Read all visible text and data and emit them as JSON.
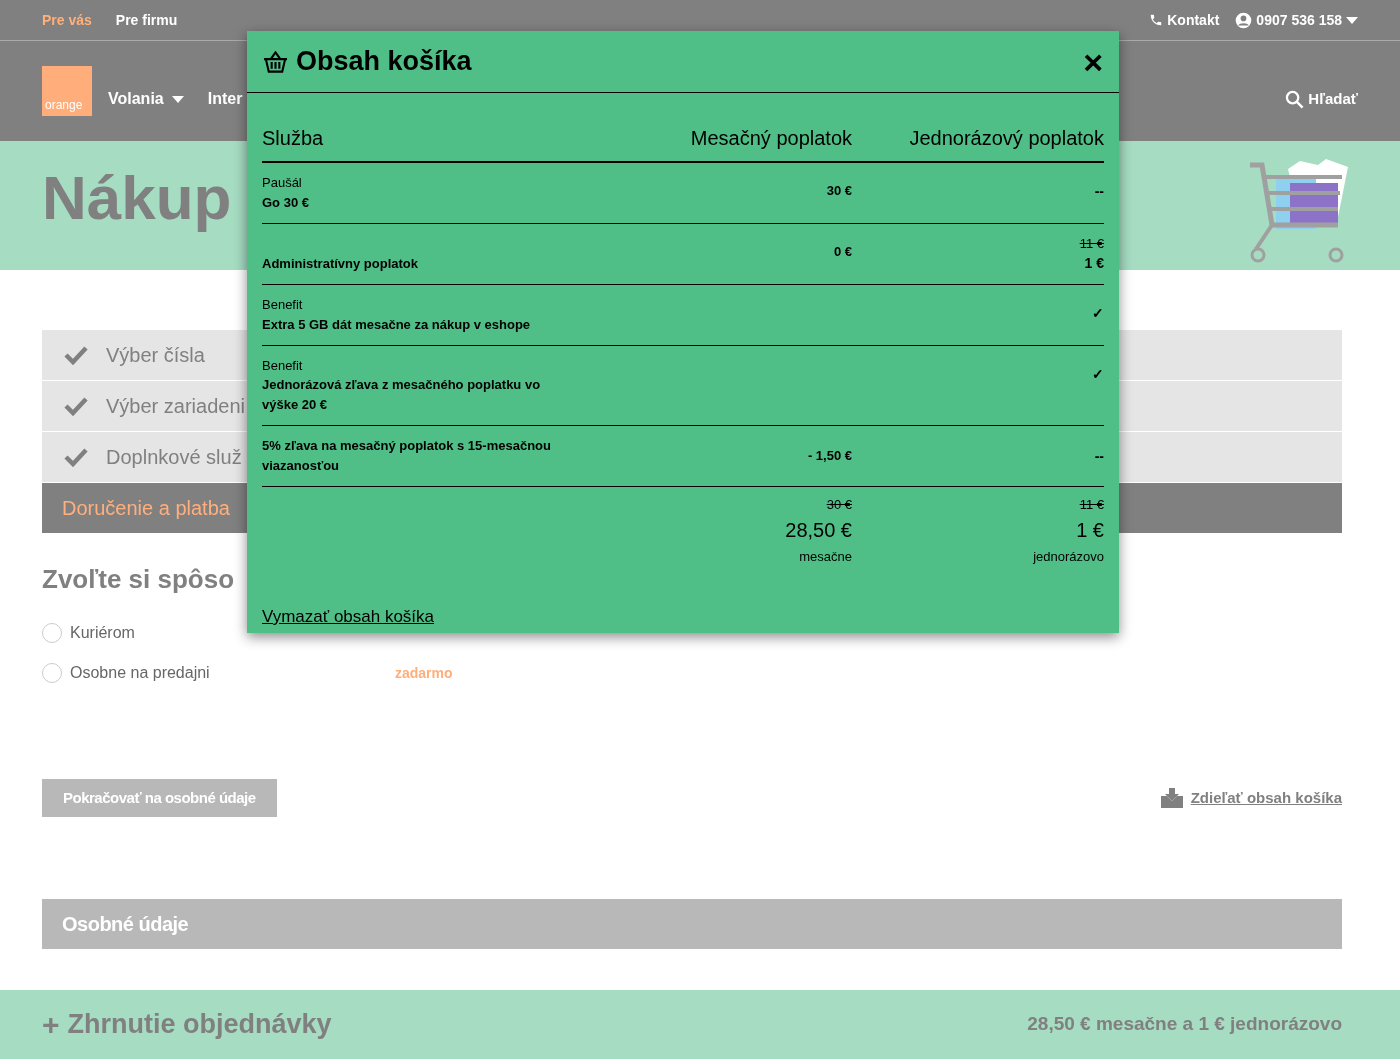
{
  "top_bar": {
    "segments": [
      {
        "label": "Pre vás",
        "selected": true
      },
      {
        "label": "Pre firmu",
        "selected": false
      }
    ],
    "contact": "Kontakt",
    "phone": "0907 536 158"
  },
  "nav": {
    "logo": "orange",
    "items": [
      {
        "label": "Volania",
        "has_menu": true
      },
      {
        "label": "Inter",
        "has_menu": false
      }
    ],
    "search": "Hľadať"
  },
  "hero": {
    "title": "Nákup"
  },
  "steps": [
    {
      "label": "Výber čísla",
      "done": true,
      "selected": false
    },
    {
      "label": "Výber zariadeni",
      "done": true,
      "selected": false
    },
    {
      "label": "Doplnkové služ",
      "done": true,
      "selected": false
    },
    {
      "label": "Doručenie a platba",
      "done": false,
      "selected": true
    }
  ],
  "delivery": {
    "heading": "Zvoľte si spôso",
    "options": [
      {
        "label": "Kuriérom",
        "selected": false
      },
      {
        "label": "Osobne na predajni",
        "selected": false,
        "price": "zadarmo"
      }
    ]
  },
  "continue_button": {
    "label": "Pokračovať na osobné údaje",
    "disabled": true
  },
  "share_link": "Zdieľať obsah košíka",
  "personal_section": {
    "title": "Osobné údaje"
  },
  "summary": {
    "toggle": "+",
    "title": "Zhrnutie objednávky",
    "total": "28,50 € mesačne a 1 € jednorázovo"
  },
  "modal": {
    "title": "Obsah košíka",
    "close": "×",
    "columns": [
      "Služba",
      "Mesačný poplatok",
      "Jednorázový poplatok"
    ],
    "rows": [
      {
        "category": "Paušál",
        "name": "Go 30 €",
        "monthly": "30 €",
        "one_time": "--"
      },
      {
        "name": "Administratívny poplatok",
        "monthly": "0 €",
        "one_time_old": "11 €",
        "one_time": "1 €"
      },
      {
        "category": "Benefit",
        "name": "Extra 5 GB dát mesačne za nákup v eshope",
        "one_time": "✓"
      },
      {
        "category": "Benefit",
        "name": "Jednorázová zľava z mesačného poplatku vo výške 20 €",
        "one_time": "✓"
      },
      {
        "name": "5% zľava na mesačný poplatok s 15-mesačnou viazanosťou",
        "monthly": "- 1,50 €",
        "one_time": "--"
      }
    ],
    "totals": [
      {
        "old": "30 €",
        "value": "28,50 €",
        "unit": "mesačne"
      },
      {
        "old": "11 €",
        "value": "1 €",
        "unit": "jednorázovo"
      }
    ],
    "clear_link": "Vymazať obsah košíka"
  }
}
